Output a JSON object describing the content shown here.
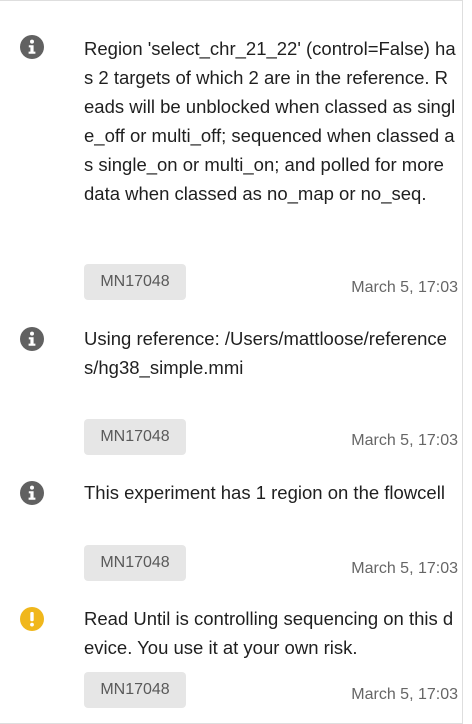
{
  "messages": [
    {
      "icon": "info-icon",
      "icon_color": "#616161",
      "text": "Region 'select_chr_21_22' (control=False) has 2 targets of which 2 are in the reference. Reads will be unblocked when classed as single_off or multi_off; sequenced when classed as single_on or multi_on; and polled for more data when classed as no_map or no_seq.",
      "device": "MN17048",
      "time": "March 5, 17:03"
    },
    {
      "icon": "info-icon",
      "icon_color": "#616161",
      "text": "Using reference: /Users/mattloose/references/hg38_simple.mmi",
      "device": "MN17048",
      "time": "March 5, 17:03"
    },
    {
      "icon": "info-icon",
      "icon_color": "#616161",
      "text": "This experiment has 1 region on the flowcell",
      "device": "MN17048",
      "time": "March 5, 17:03"
    },
    {
      "icon": "warning-icon",
      "icon_color": "#f0b71c",
      "text": "Read Until is controlling sequencing on this device. You use it at your own risk.",
      "device": "MN17048",
      "time": "March 5, 17:03"
    }
  ]
}
